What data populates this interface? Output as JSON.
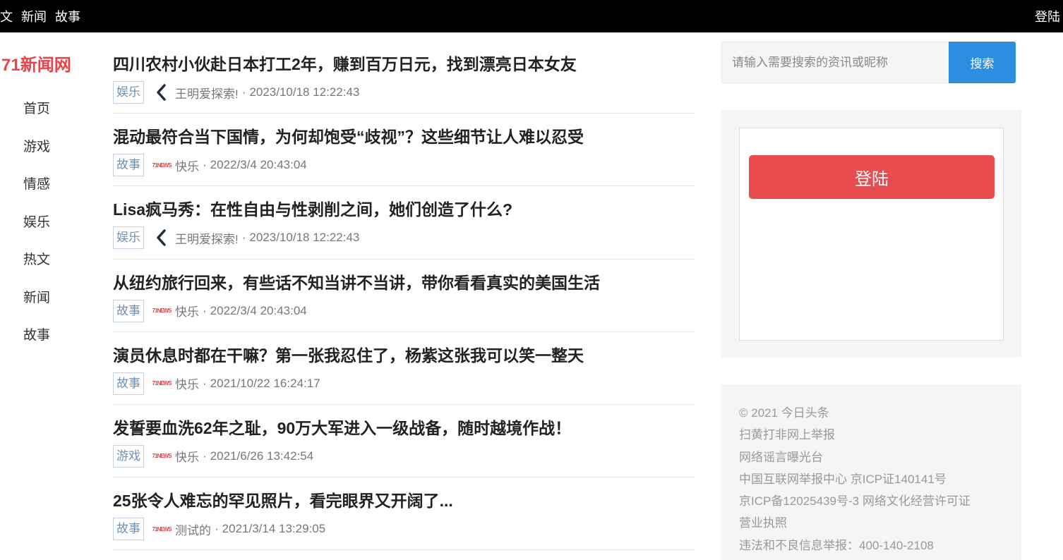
{
  "topbar": {
    "nav": [
      "文",
      "新闻",
      "故事"
    ],
    "login": "登陆"
  },
  "brand": "71新闻网",
  "sidebar": {
    "items": [
      "首页",
      "游戏",
      "情感",
      "娱乐",
      "热文",
      "新闻",
      "故事"
    ]
  },
  "articles": [
    {
      "title": "四川农村小伙赴日本打工2年，赚到百万日元，找到漂亮日本女友",
      "tag": "娱乐",
      "avatar": "chevron-left-icon",
      "author": "王明爱探索!",
      "time": "2023/10/18 12:22:43"
    },
    {
      "title": "混动最符合当下国情，为何却饱受“歧视”？这些细节让人难以忍受",
      "tag": "故事",
      "avatar": "site-logo-icon",
      "author": "快乐",
      "time": "2022/3/4 20:43:04"
    },
    {
      "title": "Lisa疯马秀：在性自由与性剥削之间，她们创造了什么?",
      "tag": "娱乐",
      "avatar": "chevron-left-icon",
      "author": "王明爱探索!",
      "time": "2023/10/18 12:22:43"
    },
    {
      "title": "从纽约旅行回来，有些话不知当讲不当讲，带你看看真实的美国生活",
      "tag": "故事",
      "avatar": "site-logo-icon",
      "author": "快乐",
      "time": "2022/3/4 20:43:04"
    },
    {
      "title": "演员休息时都在干嘛？第一张我忍住了，杨紫这张我可以笑一整天",
      "tag": "故事",
      "avatar": "site-logo-icon",
      "author": "快乐",
      "time": "2021/10/22 16:24:17"
    },
    {
      "title": "发誓要血洗62年之耻，90万大军进入一级战备，随时越境作战！",
      "tag": "游戏",
      "avatar": "site-logo-icon",
      "author": "快乐",
      "time": "2021/6/26 13:42:54"
    },
    {
      "title": "25张令人难忘的罕见照片，看完眼界又开阔了...",
      "tag": "故事",
      "avatar": "site-logo-icon",
      "author": "测试的",
      "time": "2021/3/14 13:29:05"
    }
  ],
  "meta_separator": "·",
  "search": {
    "placeholder": "请输入需要搜索的资讯或昵称",
    "button": "搜索"
  },
  "login_panel": {
    "button": "登陆"
  },
  "footer": {
    "lines": [
      "© 2021 今日头条",
      "扫黄打非网上举报",
      "网络谣言曝光台",
      "中国互联网举报中心 京ICP证140141号",
      "京ICP备12025439号-3 网络文化经营许可证",
      "营业执照",
      "违法和不良信息举报：400-140-2108"
    ]
  },
  "colors": {
    "brand": "#e8434a",
    "search_button": "#2d8ee0",
    "login_button": "#e84c4f",
    "tag_text": "#6f90b0"
  }
}
